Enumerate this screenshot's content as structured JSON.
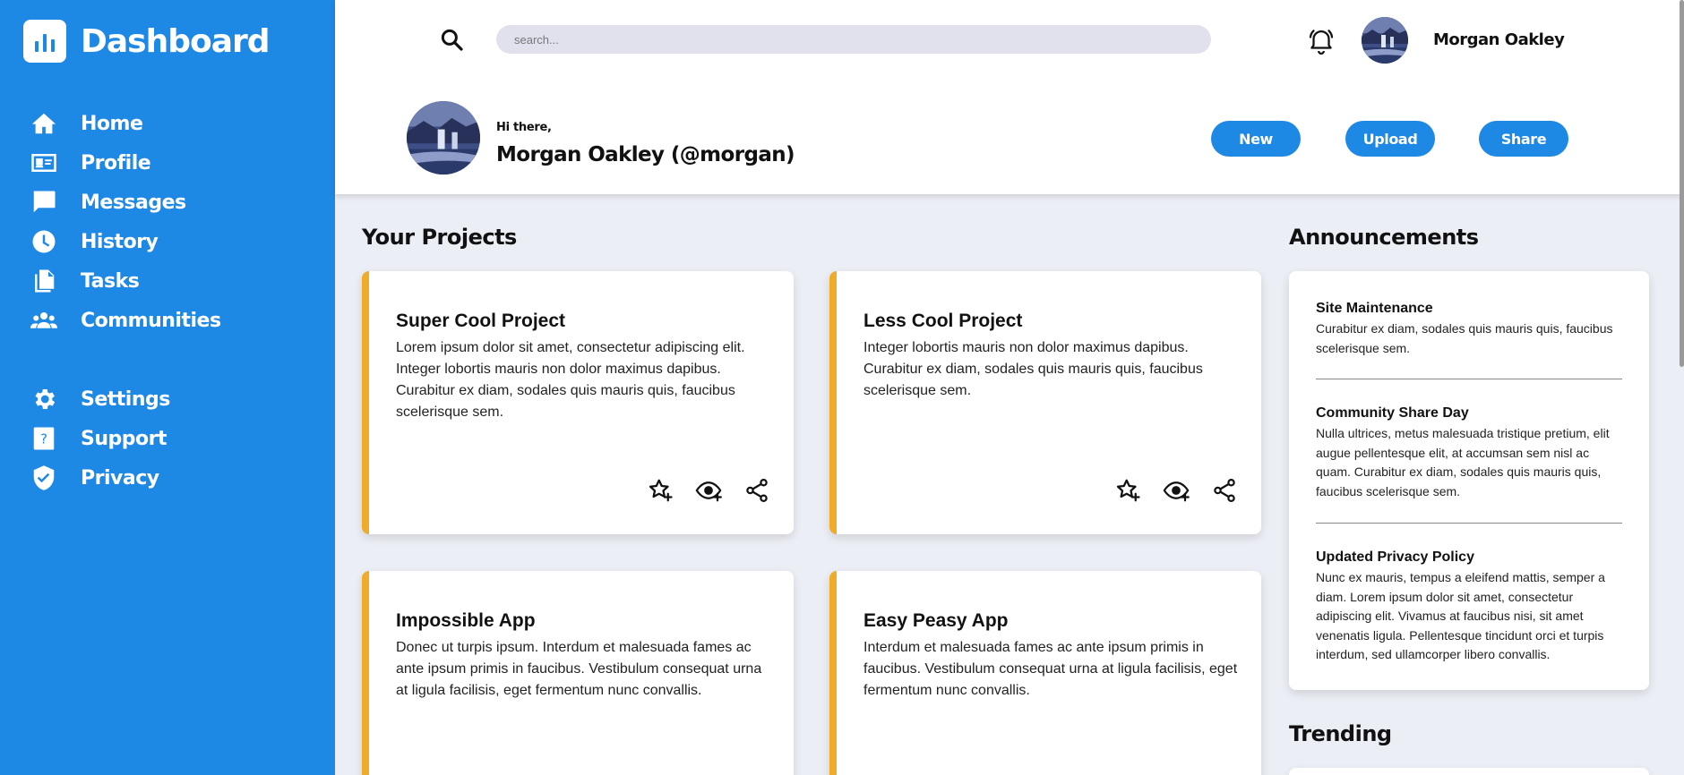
{
  "sidebar": {
    "brand": "Dashboard",
    "nav_top": [
      {
        "label": "Home",
        "icon": "home-icon"
      },
      {
        "label": "Profile",
        "icon": "profile-card-icon"
      },
      {
        "label": "Messages",
        "icon": "chat-bubble-icon"
      },
      {
        "label": "History",
        "icon": "clock-icon"
      },
      {
        "label": "Tasks",
        "icon": "documents-icon"
      },
      {
        "label": "Communities",
        "icon": "people-group-icon"
      }
    ],
    "nav_bottom": [
      {
        "label": "Settings",
        "icon": "gear-icon"
      },
      {
        "label": "Support",
        "icon": "help-icon"
      },
      {
        "label": "Privacy",
        "icon": "shield-check-icon"
      }
    ]
  },
  "header": {
    "search_placeholder": "search...",
    "user_name": "Morgan Oakley",
    "greeting": "Hi there,",
    "greeting_name": "Morgan Oakley (@morgan)",
    "buttons": {
      "new": "New",
      "upload": "Upload",
      "share": "Share"
    }
  },
  "projects": {
    "title": "Your Projects",
    "items": [
      {
        "title": "Super Cool Project",
        "description": "Lorem ipsum dolor sit amet, consectetur adipiscing elit. Integer lobortis mauris non dolor maximus dapibus. Curabitur ex diam, sodales quis mauris quis, faucibus scelerisque sem."
      },
      {
        "title": "Less Cool Project",
        "description": "Integer lobortis mauris non dolor maximus dapibus. Curabitur ex diam, sodales quis mauris quis, faucibus scelerisque sem."
      },
      {
        "title": "Impossible App",
        "description": "Donec ut turpis ipsum. Interdum et malesuada fames ac ante ipsum primis in faucibus. Vestibulum consequat urna at ligula facilisis, eget fermentum nunc convallis."
      },
      {
        "title": "Easy Peasy App",
        "description": "Interdum et malesuada fames ac ante ipsum primis in faucibus. Vestibulum consequat urna at ligula facilisis, eget fermentum nunc convallis."
      }
    ]
  },
  "announcements": {
    "title": "Announcements",
    "items": [
      {
        "title": "Site Maintenance",
        "body": "Curabitur ex diam, sodales quis mauris quis, faucibus scelerisque sem."
      },
      {
        "title": "Community Share Day",
        "body": "Nulla ultrices, metus malesuada tristique pretium, elit augue pellentesque elit, at accumsan sem nisl ac quam. Curabitur ex diam, sodales quis mauris quis, faucibus scelerisque sem."
      },
      {
        "title": "Updated Privacy Policy",
        "body": "Nunc ex mauris, tempus a eleifend mattis, semper a diam. Lorem ipsum dolor sit amet, consectetur adipiscing elit. Vivamus at faucibus nisi, sit amet venenatis ligula. Pellentesque tincidunt orci et turpis interdum, sed ullamcorper libero convallis."
      }
    ]
  },
  "trending": {
    "title": "Trending"
  },
  "colors": {
    "sidebar": "#1e88e5",
    "accent": "#f0ab28",
    "background": "#eceef5"
  }
}
